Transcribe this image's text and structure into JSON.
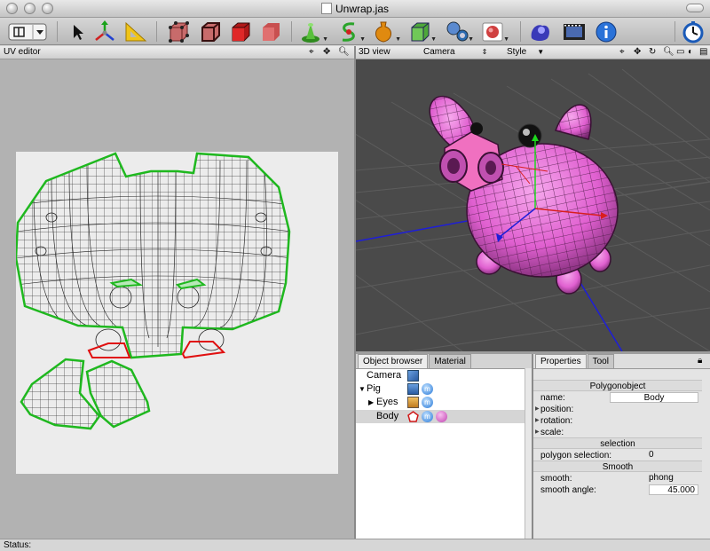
{
  "window": {
    "title": "Unwrap.jas"
  },
  "toolbar": {
    "tools": [
      {
        "name": "layout-toggle-icon"
      },
      {
        "name": "select-arrow-icon"
      },
      {
        "name": "move-axes-icon"
      },
      {
        "name": "set-square-icon"
      },
      {
        "name": "vertex-mode-icon"
      },
      {
        "name": "edge-mode-icon"
      },
      {
        "name": "face-mode-icon"
      },
      {
        "name": "object-mode-icon"
      },
      {
        "name": "primitive-icon"
      },
      {
        "name": "spline-icon"
      },
      {
        "name": "vase-icon"
      },
      {
        "name": "box-icon"
      },
      {
        "name": "camera-icon"
      },
      {
        "name": "material-icon"
      },
      {
        "name": "render-icon"
      },
      {
        "name": "film-icon"
      },
      {
        "name": "info-icon"
      },
      {
        "name": "clock-icon"
      }
    ]
  },
  "uv_editor": {
    "title": "UV editor",
    "icons": [
      "crosshair-icon",
      "move-icon",
      "zoom-icon"
    ]
  },
  "view3d": {
    "title": "3D view",
    "camera_label": "Camera",
    "style_label": "Style",
    "icons": [
      "crosshair-icon",
      "move-icon",
      "rotate-icon",
      "zoom-icon",
      "maximize-icon",
      "toggle-icon",
      "split-icon"
    ]
  },
  "object_browser": {
    "tabs": [
      "Object browser",
      "Material"
    ],
    "items": [
      {
        "label": "Camera",
        "depth": 0
      },
      {
        "label": "Pig",
        "depth": 0,
        "expanded": true
      },
      {
        "label": "Eyes",
        "depth": 1,
        "expanded": false
      },
      {
        "label": "Body",
        "depth": 1,
        "selected": true
      }
    ]
  },
  "properties": {
    "tabs": [
      "Properties",
      "Tool"
    ],
    "section_object": "Polygonobject",
    "name_label": "name:",
    "name_value": "Body",
    "position_label": "position:",
    "rotation_label": "rotation:",
    "scale_label": "scale:",
    "section_selection": "selection",
    "polygon_selection_label": "polygon selection:",
    "polygon_selection_value": "0",
    "section_smooth": "Smooth",
    "smooth_label": "smooth:",
    "smooth_value": "phong",
    "smooth_angle_label": "smooth angle:",
    "smooth_angle_value": "45.000"
  },
  "status": {
    "label": "Status:"
  },
  "colors": {
    "uv_outline": "#1fb81f",
    "uv_seam": "#e01010",
    "pig_pink": "#e060d0",
    "axis_red": "#d81e1e",
    "axis_green": "#1ed81e",
    "axis_blue": "#1e1ed8",
    "grid": "#5c5c5c"
  }
}
